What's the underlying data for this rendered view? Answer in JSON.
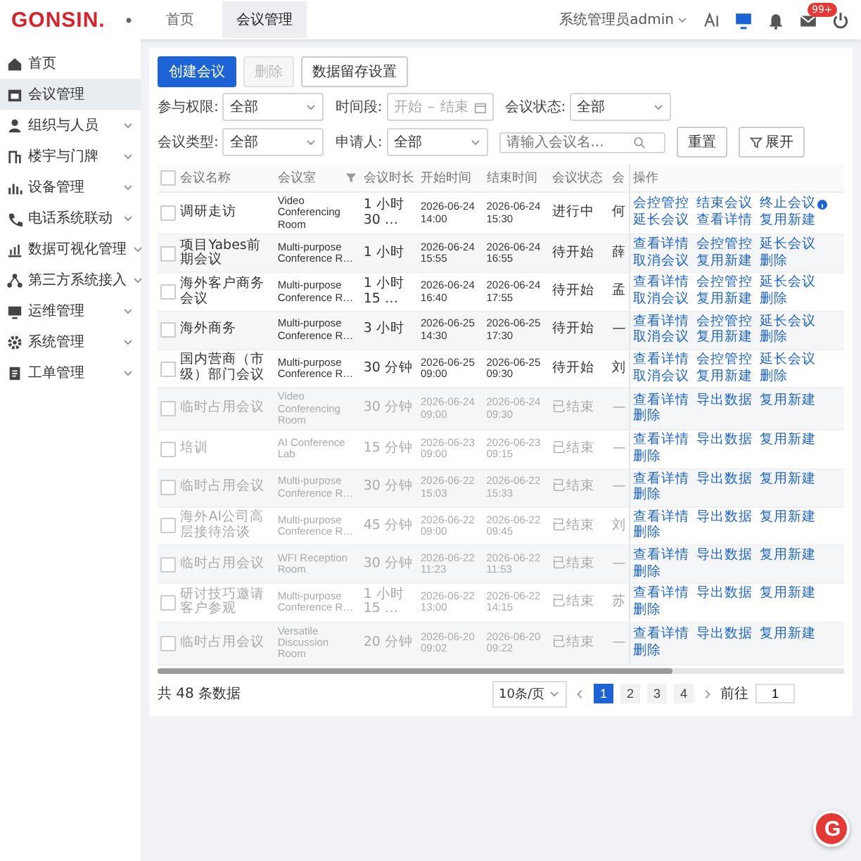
{
  "header": {
    "logo": "GONSIN.",
    "tabs": [
      {
        "label": "首页",
        "selected": false
      },
      {
        "label": "会议管理",
        "selected": true
      }
    ],
    "user": "系统管理员admin",
    "badge": "99+"
  },
  "sidebar": {
    "items": [
      {
        "label": "首页",
        "expandable": false,
        "selected": false
      },
      {
        "label": "会议管理",
        "expandable": false,
        "selected": true
      },
      {
        "label": "组织与人员",
        "expandable": true,
        "selected": false
      },
      {
        "label": "楼宇与门牌",
        "expandable": true,
        "selected": false
      },
      {
        "label": "设备管理",
        "expandable": true,
        "selected": false
      },
      {
        "label": "电话系统联动",
        "expandable": true,
        "selected": false
      },
      {
        "label": "数据可视化管理",
        "expandable": true,
        "selected": false
      },
      {
        "label": "第三方系统接入",
        "expandable": true,
        "selected": false
      },
      {
        "label": "运维管理",
        "expandable": true,
        "selected": false
      },
      {
        "label": "系统管理",
        "expandable": true,
        "selected": false
      },
      {
        "label": "工单管理",
        "expandable": true,
        "selected": false
      }
    ]
  },
  "toolbar": {
    "buttons": [
      {
        "label": "创建会议",
        "kind": "primary",
        "disabled": false
      },
      {
        "label": "删除",
        "kind": "default",
        "disabled": true
      },
      {
        "label": "数据留存设置",
        "kind": "default",
        "disabled": false
      }
    ]
  },
  "filters": [
    {
      "label": "参与权限:",
      "kind": "select",
      "value": "全部"
    },
    {
      "label": "时间段:",
      "kind": "range",
      "start_placeholder": "开始",
      "separator": "–",
      "end_placeholder": "结束"
    },
    {
      "label": "会议状态:",
      "kind": "select",
      "value": "全部"
    },
    {
      "label": "会议类型:",
      "kind": "select",
      "value": "全部"
    },
    {
      "label": "申请人:",
      "kind": "select",
      "value": "全部"
    }
  ],
  "search": {
    "placeholder": "请输入会议名..."
  },
  "actions": [
    {
      "label": "重置",
      "kind": "plain"
    },
    {
      "label": "展开",
      "kind": "filter"
    }
  ],
  "table": {
    "header_checked": false,
    "columns": [
      {
        "label": "会议名称",
        "filterable": false
      },
      {
        "label": "会议室",
        "filterable": true
      },
      {
        "label": "会议时长",
        "filterable": false
      },
      {
        "label": "开始时间",
        "filterable": false
      },
      {
        "label": "结束时间",
        "filterable": false
      },
      {
        "label": "会议状态",
        "filterable": false
      },
      {
        "label": "会",
        "filterable": false
      },
      {
        "label": "操作",
        "filterable": false
      }
    ],
    "rows": [
      {
        "checked": false,
        "ended": false,
        "cells": [
          "调研走访",
          "Video Conferencing Room",
          "1 小时 30 …",
          "2026-06-24 14:00",
          "2026-06-24 15:30",
          "进行中",
          "何"
        ],
        "ops": [
          {
            "label": "会控管控",
            "hint": false
          },
          {
            "label": "结束会议",
            "hint": false
          },
          {
            "label": "终止会议",
            "hint": true
          },
          {
            "label": "延长会议",
            "hint": false
          },
          {
            "label": "查看详情",
            "hint": false
          },
          {
            "label": "复用新建",
            "hint": false
          }
        ]
      },
      {
        "checked": false,
        "ended": false,
        "cells": [
          "项目Yabes前期会议",
          "Multi-purpose Conference R…",
          "1 小时",
          "2026-06-24 15:55",
          "2026-06-24 16:55",
          "待开始",
          "薛"
        ],
        "ops": [
          {
            "label": "查看详情",
            "hint": false
          },
          {
            "label": "会控管控",
            "hint": false
          },
          {
            "label": "延长会议",
            "hint": false
          },
          {
            "label": "取消会议",
            "hint": false
          },
          {
            "label": "复用新建",
            "hint": false
          },
          {
            "label": "删除",
            "hint": false
          }
        ]
      },
      {
        "checked": false,
        "ended": false,
        "cells": [
          "海外客户商务会议",
          "Multi-purpose Conference R…",
          "1 小时 15 …",
          "2026-06-24 16:40",
          "2026-06-24 17:55",
          "待开始",
          "孟"
        ],
        "ops": [
          {
            "label": "查看详情",
            "hint": false
          },
          {
            "label": "会控管控",
            "hint": false
          },
          {
            "label": "延长会议",
            "hint": false
          },
          {
            "label": "取消会议",
            "hint": false
          },
          {
            "label": "复用新建",
            "hint": false
          },
          {
            "label": "删除",
            "hint": false
          }
        ]
      },
      {
        "checked": false,
        "ended": false,
        "cells": [
          "海外商务",
          "Multi-purpose Conference R…",
          "3 小时",
          "2026-06-25 14:30",
          "2026-06-25 17:30",
          "待开始",
          "—"
        ],
        "ops": [
          {
            "label": "查看详情",
            "hint": false
          },
          {
            "label": "会控管控",
            "hint": false
          },
          {
            "label": "延长会议",
            "hint": false
          },
          {
            "label": "取消会议",
            "hint": false
          },
          {
            "label": "复用新建",
            "hint": false
          },
          {
            "label": "删除",
            "hint": false
          }
        ]
      },
      {
        "checked": false,
        "ended": false,
        "cells": [
          "国内营商（市级）部门会议",
          "Multi-purpose Conference R…",
          "30 分钟",
          "2026-06-25 09:00",
          "2026-06-25 09:30",
          "待开始",
          "刘"
        ],
        "ops": [
          {
            "label": "查看详情",
            "hint": false
          },
          {
            "label": "会控管控",
            "hint": false
          },
          {
            "label": "延长会议",
            "hint": false
          },
          {
            "label": "取消会议",
            "hint": false
          },
          {
            "label": "复用新建",
            "hint": false
          },
          {
            "label": "删除",
            "hint": false
          }
        ]
      },
      {
        "checked": false,
        "ended": true,
        "cells": [
          "临时占用会议",
          "Video Conferencing Room",
          "30 分钟",
          "2026-06-24 09:00",
          "2026-06-24 09:30",
          "已结束",
          "—"
        ],
        "ops": [
          {
            "label": "查看详情",
            "hint": false
          },
          {
            "label": "导出数据",
            "hint": false
          },
          {
            "label": "复用新建",
            "hint": false
          },
          {
            "label": "删除",
            "hint": false
          }
        ]
      },
      {
        "checked": false,
        "ended": true,
        "cells": [
          "培训",
          "AI Conference Lab",
          "15 分钟",
          "2026-06-23 09:00",
          "2026-06-23 09:15",
          "已结束",
          "—"
        ],
        "ops": [
          {
            "label": "查看详情",
            "hint": false
          },
          {
            "label": "导出数据",
            "hint": false
          },
          {
            "label": "复用新建",
            "hint": false
          },
          {
            "label": "删除",
            "hint": false
          }
        ]
      },
      {
        "checked": false,
        "ended": true,
        "cells": [
          "临时占用会议",
          "Multi-purpose Conference R…",
          "30 分钟",
          "2026-06-22 15:03",
          "2026-06-22 15:33",
          "已结束",
          "—"
        ],
        "ops": [
          {
            "label": "查看详情",
            "hint": false
          },
          {
            "label": "导出数据",
            "hint": false
          },
          {
            "label": "复用新建",
            "hint": false
          },
          {
            "label": "删除",
            "hint": false
          }
        ]
      },
      {
        "checked": false,
        "ended": true,
        "cells": [
          "海外AI公司高层接待洽谈",
          "Multi-purpose Conference R…",
          "45 分钟",
          "2026-06-22 09:00",
          "2026-06-22 09:45",
          "已结束",
          "刘"
        ],
        "ops": [
          {
            "label": "查看详情",
            "hint": false
          },
          {
            "label": "导出数据",
            "hint": false
          },
          {
            "label": "复用新建",
            "hint": false
          },
          {
            "label": "删除",
            "hint": false
          }
        ]
      },
      {
        "checked": false,
        "ended": true,
        "cells": [
          "临时占用会议",
          "WFI Reception Room",
          "30 分钟",
          "2026-06-22 11:23",
          "2026-06-22 11:53",
          "已结束",
          "—"
        ],
        "ops": [
          {
            "label": "查看详情",
            "hint": false
          },
          {
            "label": "导出数据",
            "hint": false
          },
          {
            "label": "复用新建",
            "hint": false
          },
          {
            "label": "删除",
            "hint": false
          }
        ]
      },
      {
        "checked": false,
        "ended": true,
        "cells": [
          "研讨技巧邀请客户参观",
          "Multi-purpose Conference R…",
          "1 小时 15 …",
          "2026-06-22 13:00",
          "2026-06-22 14:15",
          "已结束",
          "苏"
        ],
        "ops": [
          {
            "label": "查看详情",
            "hint": false
          },
          {
            "label": "导出数据",
            "hint": false
          },
          {
            "label": "复用新建",
            "hint": false
          },
          {
            "label": "删除",
            "hint": false
          }
        ]
      },
      {
        "checked": false,
        "ended": true,
        "cells": [
          "临时占用会议",
          "Versatile Discussion Room",
          "20 分钟",
          "2026-06-20 09:02",
          "2026-06-20 09:22",
          "已结束",
          "—"
        ],
        "ops": [
          {
            "label": "查看详情",
            "hint": false
          },
          {
            "label": "导出数据",
            "hint": false
          },
          {
            "label": "复用新建",
            "hint": false
          },
          {
            "label": "删除",
            "hint": false
          }
        ]
      }
    ]
  },
  "footer": {
    "total": "共 48 条数据",
    "page_size": "10条/页",
    "pages": [
      {
        "label": "1",
        "selected": true
      },
      {
        "label": "2",
        "selected": false
      },
      {
        "label": "3",
        "selected": false
      },
      {
        "label": "4",
        "selected": false
      }
    ],
    "jump_label": "前往",
    "jump_value": "1"
  },
  "float_button": {
    "label": "G"
  }
}
